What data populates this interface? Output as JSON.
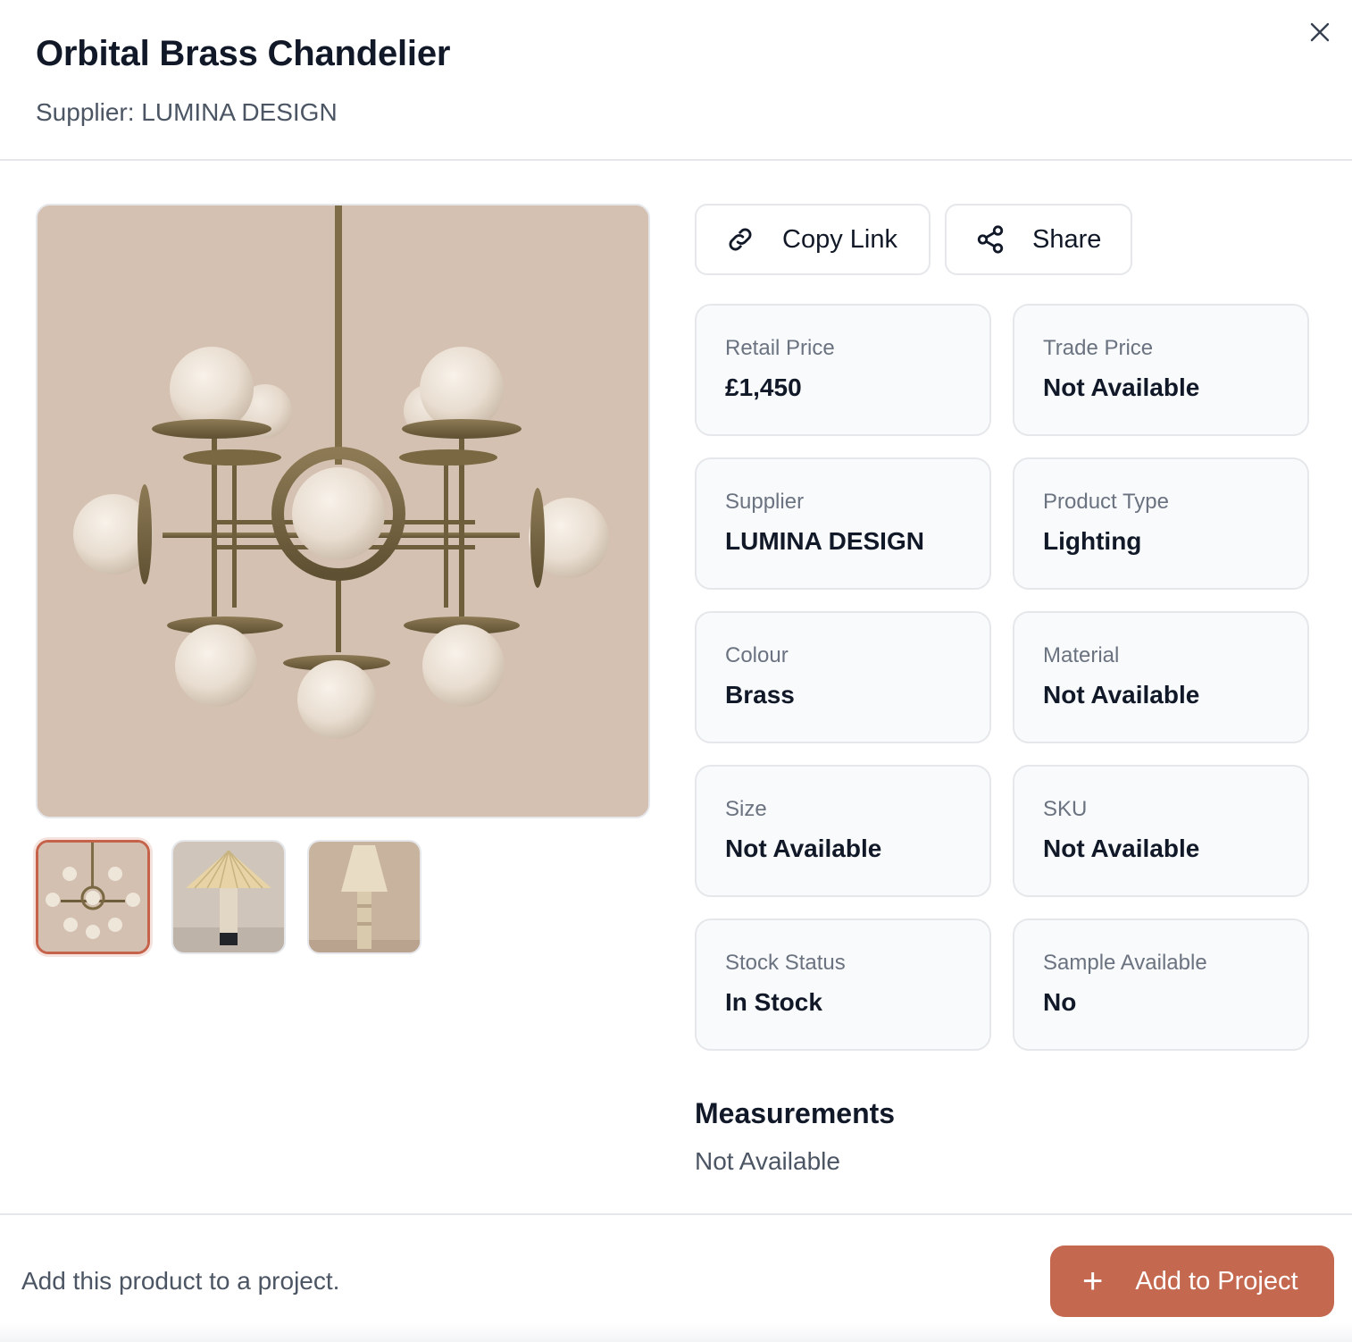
{
  "product": {
    "title": "Orbital Brass Chandelier",
    "supplier_line": "Supplier: LUMINA DESIGN"
  },
  "actions": {
    "copy_link": "Copy Link",
    "share": "Share"
  },
  "details": [
    {
      "label": "Retail Price",
      "value": "£1,450"
    },
    {
      "label": "Trade Price",
      "value": "Not Available"
    },
    {
      "label": "Supplier",
      "value": "LUMINA DESIGN"
    },
    {
      "label": "Product Type",
      "value": "Lighting"
    },
    {
      "label": "Colour",
      "value": "Brass"
    },
    {
      "label": "Material",
      "value": "Not Available"
    },
    {
      "label": "Size",
      "value": "Not Available"
    },
    {
      "label": "SKU",
      "value": "Not Available"
    },
    {
      "label": "Stock Status",
      "value": "In Stock"
    },
    {
      "label": "Sample Available",
      "value": "No"
    }
  ],
  "measurements": {
    "title": "Measurements",
    "value": "Not Available"
  },
  "footer": {
    "prompt": "Add this product to a project.",
    "add_button": "Add to Project"
  },
  "gallery": {
    "selected_index": 0,
    "thumbnails": [
      "chandelier",
      "pleated-table-lamp",
      "textured-table-lamp"
    ]
  },
  "colors": {
    "accent": "#c4694f",
    "card_bg": "#f8fafc",
    "border": "#e5e7eb"
  }
}
